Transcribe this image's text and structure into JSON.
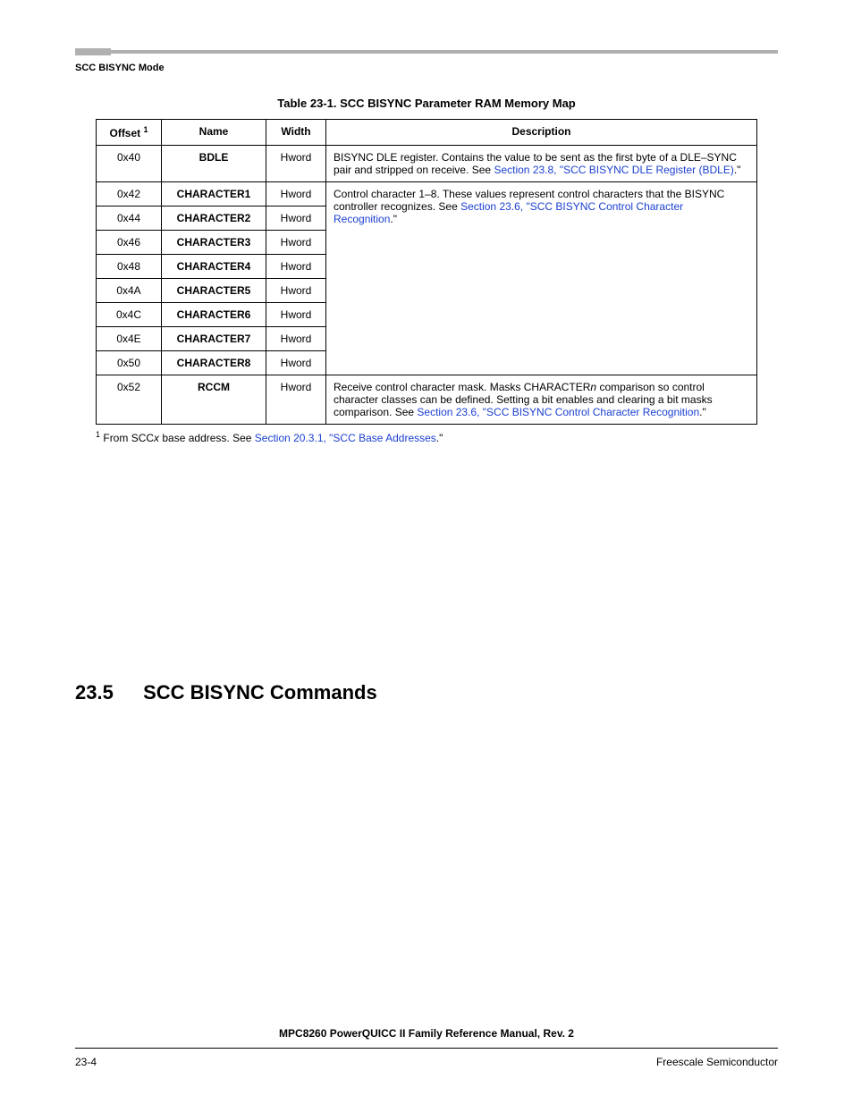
{
  "running_head": "SCC BISYNC Mode",
  "table_caption": "Table 23-1. SCC BISYNC Parameter RAM Memory Map",
  "headers": {
    "offset": "Offset",
    "offset_sup": "1",
    "name": "Name",
    "width": "Width",
    "description": "Description"
  },
  "rows": [
    {
      "offset": "0x40",
      "name": "BDLE",
      "width": "Hword"
    },
    {
      "offset": "0x42",
      "name": "CHARACTER1",
      "width": "Hword"
    },
    {
      "offset": "0x44",
      "name": "CHARACTER2",
      "width": "Hword"
    },
    {
      "offset": "0x46",
      "name": "CHARACTER3",
      "width": "Hword"
    },
    {
      "offset": "0x48",
      "name": "CHARACTER4",
      "width": "Hword"
    },
    {
      "offset": "0x4A",
      "name": "CHARACTER5",
      "width": "Hword"
    },
    {
      "offset": "0x4C",
      "name": "CHARACTER6",
      "width": "Hword"
    },
    {
      "offset": "0x4E",
      "name": "CHARACTER7",
      "width": "Hword"
    },
    {
      "offset": "0x50",
      "name": "CHARACTER8",
      "width": "Hword"
    },
    {
      "offset": "0x52",
      "name": "RCCM",
      "width": "Hword"
    }
  ],
  "desc_bdle": {
    "pre": "BISYNC DLE register. Contains the value to be sent as the first byte of a DLE–SYNC pair and stripped on receive. See ",
    "link": "Section 23.8, \"SCC BISYNC DLE Register (BDLE)",
    "post": ".\""
  },
  "desc_char": {
    "pre": "Control character 1–8. These values represent control characters that the BISYNC controller recognizes. See ",
    "link": "Section 23.6, \"SCC BISYNC Control Character Recognition",
    "post": ".\""
  },
  "desc_rccm": {
    "pre1": "Receive control character mask. Masks CHARACTER",
    "italic": "n",
    "pre2": " comparison so control character classes can be defined. Setting a bit enables and clearing a bit masks comparison. See ",
    "link": "Section 23.6, \"SCC BISYNC Control Character Recognition",
    "post": ".\""
  },
  "footnote": {
    "num": "1",
    "pre": "From SCC",
    "italic": "x",
    "mid": " base address. See ",
    "link": "Section 20.3.1, \"SCC Base Addresses",
    "post": ".\""
  },
  "section": {
    "num": "23.5",
    "title": "SCC BISYNC Commands"
  },
  "footer": {
    "title": "MPC8260 PowerQUICC II Family Reference Manual, Rev. 2",
    "page": "23-4",
    "vendor": "Freescale Semiconductor"
  }
}
